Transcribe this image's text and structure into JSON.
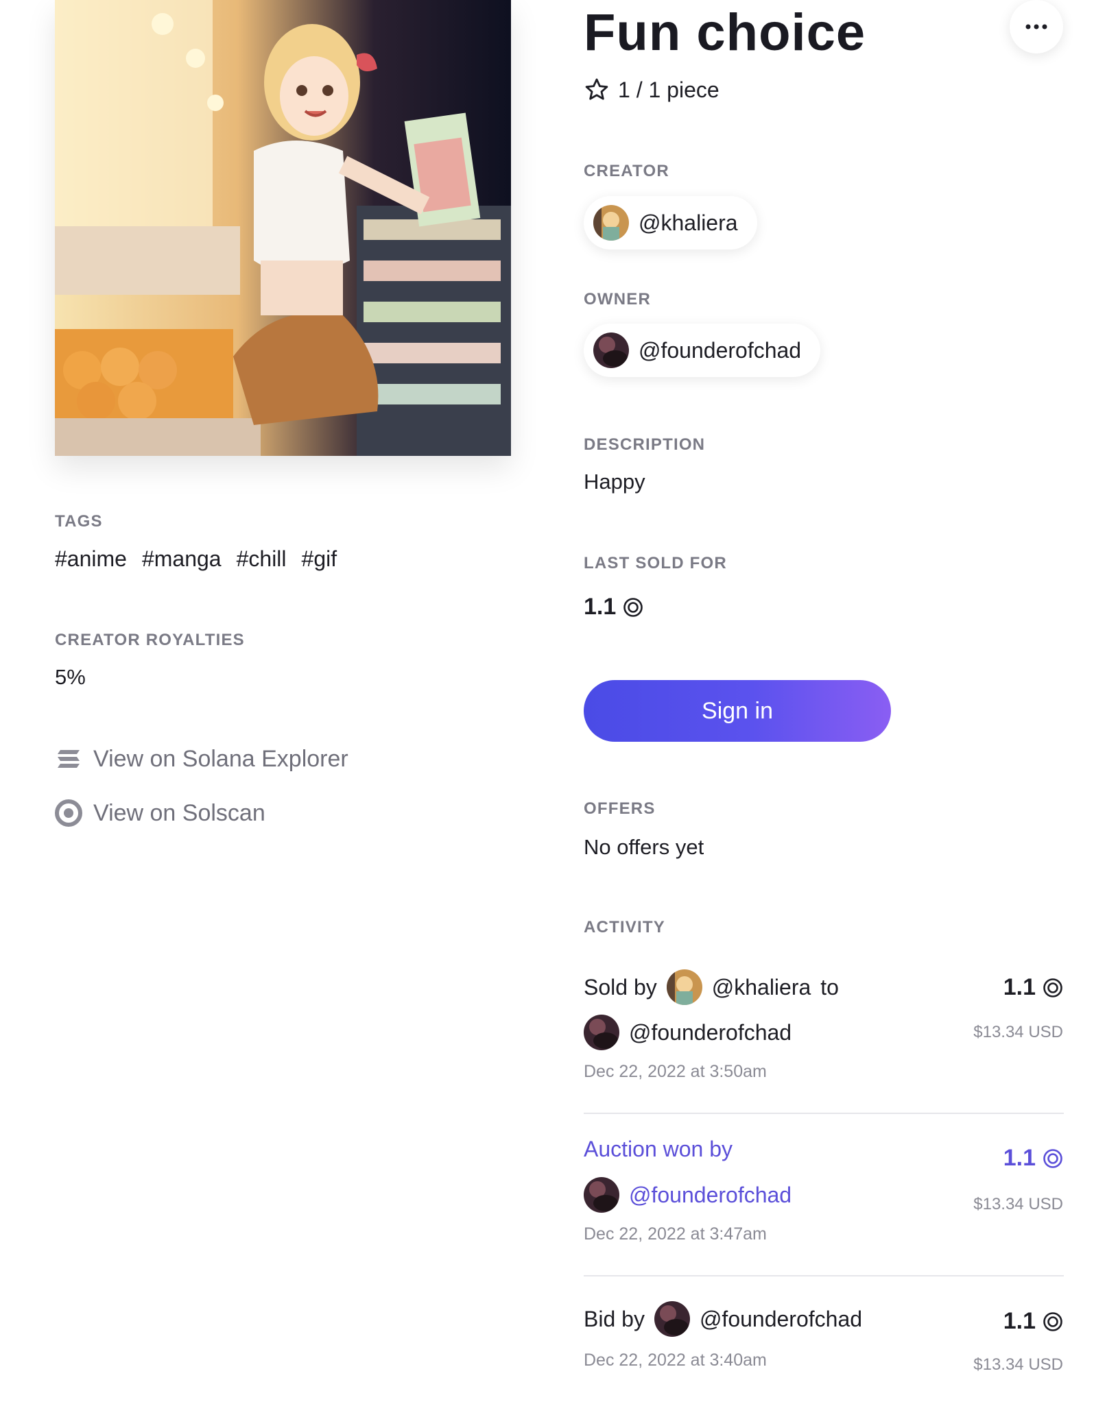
{
  "nft": {
    "title": "Fun choice",
    "edition": "1 / 1 piece",
    "creator_label": "CREATOR",
    "creator": "@khaliera",
    "owner_label": "OWNER",
    "owner": "@founderofchad",
    "description_label": "DESCRIPTION",
    "description": "Happy",
    "last_sold_label": "LAST SOLD FOR",
    "last_sold": "1.1"
  },
  "left": {
    "tags_label": "TAGS",
    "tags": [
      "#anime",
      "#manga",
      "#chill",
      "#gif"
    ],
    "royalties_label": "CREATOR ROYALTIES",
    "royalties": "5%",
    "explorer_link": "View on Solana Explorer",
    "solscan_link": "View on Solscan"
  },
  "actions": {
    "signin": "Sign in"
  },
  "offers": {
    "label": "OFFERS",
    "empty": "No offers yet"
  },
  "activity": {
    "label": "ACTIVITY",
    "items": [
      {
        "prefix": "Sold by",
        "user": "@khaliera",
        "mid": "to",
        "user2": "@founderofchad",
        "date": "Dec 22, 2022 at 3:50am",
        "price": "1.1",
        "usd": "$13.34 USD"
      },
      {
        "prefix": "Auction won by",
        "user": "@founderofchad",
        "date": "Dec 22, 2022 at 3:47am",
        "price": "1.1",
        "usd": "$13.34 USD"
      },
      {
        "prefix": "Bid by",
        "user": "@founderofchad",
        "date": "Dec 22, 2022 at 3:40am",
        "price": "1.1",
        "usd": "$13.34 USD"
      }
    ]
  },
  "colors": {
    "accent": "#5b4fd9",
    "button_start": "#4a4be6",
    "button_end": "#8a5ef3"
  },
  "icons": {
    "more": "more-horizontal-icon",
    "edition": "star-outline-icon",
    "currency": "solana-coin-icon",
    "explorer": "solana-logo-icon",
    "solscan": "solscan-logo-icon"
  }
}
